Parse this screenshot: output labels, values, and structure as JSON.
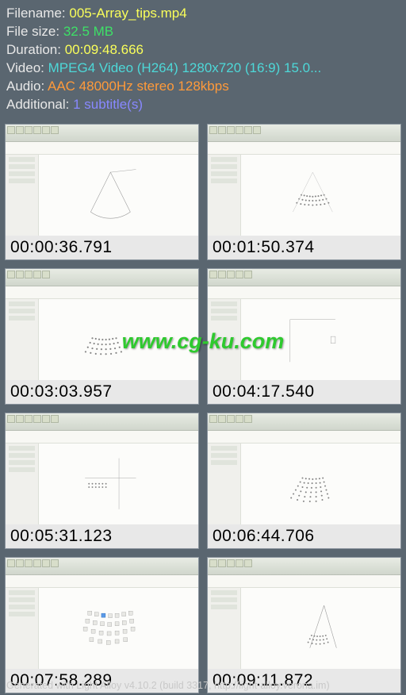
{
  "metadata": {
    "filename_label": "Filename:",
    "filename_value": "005-Array_tips.mp4",
    "filesize_label": "File size:",
    "filesize_value": "32.5 MB",
    "duration_label": "Duration:",
    "duration_value": "00:09:48.666",
    "video_label": "Video:",
    "video_value": "MPEG4 Video (H264) 1280x720 (16:9) 15.0...",
    "audio_label": "Audio:",
    "audio_value": "AAC 48000Hz stereo 128kbps",
    "additional_label": "Additional:",
    "additional_value": "1 subtitle(s)"
  },
  "thumbnails": [
    {
      "timestamp": "00:00:36.791"
    },
    {
      "timestamp": "00:01:50.374"
    },
    {
      "timestamp": "00:03:03.957"
    },
    {
      "timestamp": "00:04:17.540"
    },
    {
      "timestamp": "00:05:31.123"
    },
    {
      "timestamp": "00:06:44.706"
    },
    {
      "timestamp": "00:07:58.289"
    },
    {
      "timestamp": "00:09:11.872"
    }
  ],
  "watermark": "www.cg-ku.com",
  "footer": "Generated with Light Alloy v4.10.2 (build 3317, http://light-alloy.verona.im)"
}
